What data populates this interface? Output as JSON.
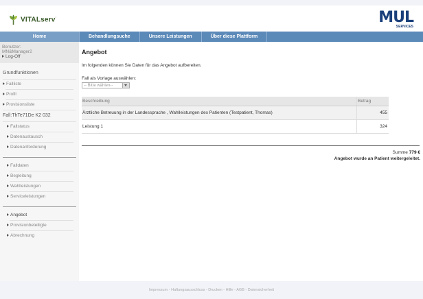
{
  "brand": {
    "name": "VITALserv",
    "trademark": "·",
    "partner_big": "MUL",
    "partner_small": "SERVICES"
  },
  "nav": {
    "home": "Home",
    "items": [
      "Behandlungsuche",
      "Unsere Leistungen",
      "Über diese Plattform"
    ]
  },
  "sidebar": {
    "user_label": "Benutzer:",
    "user_name": "MN&Manager2",
    "logoff": "Log-Off",
    "section1_title": "Grundfunktionen",
    "section1_items": [
      "Fallliste",
      "Profil",
      "Provisionsliste"
    ],
    "case_title": "Fall:ThTe71De K2 032",
    "case_items": [
      "Fallstatus",
      "Datenaustausch",
      "Datenanforderung"
    ],
    "group2": [
      "Falldaten",
      "Begleitung",
      "Wahlleistungen",
      "Serviceleistungen"
    ],
    "group3": [
      "Angebot",
      "Provisionbeteiligte",
      "Abrechnung"
    ]
  },
  "main": {
    "title": "Angebot",
    "intro": "Im folgenden können Sie Daten für das Angebot aufbereiten.",
    "vorlage_label": "Fall als Vorlage auswählen:",
    "select_value": "-- Bitte wählen--",
    "table": {
      "headers": [
        "Beschreibung",
        "Betrag"
      ],
      "rows": [
        {
          "desc": "Ärztliche Betreuung in der Landessprache , Wahlleistungen des Patienten (Testpatient, Thomas)",
          "amount": "455"
        },
        {
          "desc": "Leistung 1",
          "amount": "324"
        }
      ]
    },
    "sum_label": "Summe",
    "sum_value": "779 €",
    "sent_text": "Angebot wurde an Patient weitergeleitet."
  },
  "footer": {
    "links": [
      "Impressum",
      "Haftungsausschluss",
      "Drucken",
      "Hilfe",
      "AGB",
      "Datensicherheit"
    ],
    "separator": "-"
  }
}
